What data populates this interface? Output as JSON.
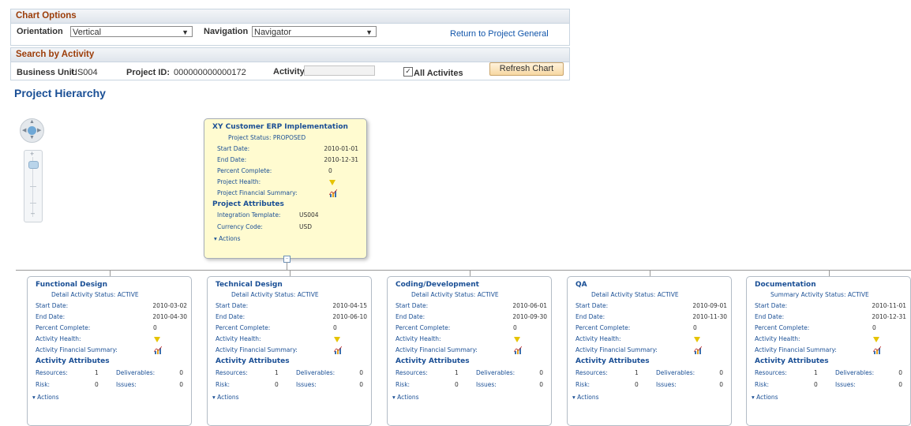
{
  "chart_options": {
    "header": "Chart Options",
    "orientation_label": "Orientation",
    "orientation_value": "Vertical",
    "navigation_label": "Navigation",
    "navigation_value": "Navigator",
    "return_link": "Return to Project General"
  },
  "search": {
    "header": "Search by Activity",
    "business_unit_label": "Business Unit:",
    "business_unit_value": "US004",
    "project_id_label": "Project ID:",
    "project_id_value": "000000000000172",
    "activity_label": "Activity:",
    "activity_value": "",
    "all_activities_label": "All Activites",
    "all_activities_checked": true,
    "refresh_button": "Refresh Chart"
  },
  "page_title": "Project Hierarchy",
  "root": {
    "title": "XY Customer ERP Implementation",
    "status": "Project Status: PROPOSED",
    "rows": [
      {
        "label": "Start Date:",
        "value": "2010-01-01"
      },
      {
        "label": "End Date:",
        "value": "2010-12-31"
      },
      {
        "label": "Percent Complete:",
        "value": "0"
      },
      {
        "label": "Project Health:",
        "value": ""
      },
      {
        "label": "Project Financial Summary:",
        "value": ""
      }
    ],
    "attributes_header": "Project Attributes",
    "attributes": [
      {
        "label": "Integration Template:",
        "value": "US004"
      },
      {
        "label": "Currency Code:",
        "value": "USD"
      }
    ],
    "actions": "Actions",
    "health_color": "#e6c300"
  },
  "activities": [
    {
      "title": "Functional Design",
      "status": "Detail Activity Status: ACTIVE",
      "start": "2010-03-02",
      "end": "2010-04-30",
      "percent": "0",
      "resources": "1",
      "deliverables": "0",
      "risk": "0",
      "issues": "0"
    },
    {
      "title": "Technical Design",
      "status": "Detail Activity Status: ACTIVE",
      "start": "2010-04-15",
      "end": "2010-06-10",
      "percent": "0",
      "resources": "1",
      "deliverables": "0",
      "risk": "0",
      "issues": "0"
    },
    {
      "title": "Coding/Development",
      "status": "Detail Activity Status: ACTIVE",
      "start": "2010-06-01",
      "end": "2010-09-30",
      "percent": "0",
      "resources": "1",
      "deliverables": "0",
      "risk": "0",
      "issues": "0"
    },
    {
      "title": "QA",
      "status": "Detail Activity Status: ACTIVE",
      "start": "2010-09-01",
      "end": "2010-11-30",
      "percent": "0",
      "resources": "1",
      "deliverables": "0",
      "risk": "0",
      "issues": "0"
    },
    {
      "title": "Documentation",
      "status": "Summary Activity Status: ACTIVE",
      "start": "2010-11-01",
      "end": "2010-12-31",
      "percent": "0",
      "resources": "1",
      "deliverables": "0",
      "risk": "0",
      "issues": "0"
    }
  ],
  "activity_labels": {
    "start": "Start Date:",
    "end": "End Date:",
    "percent": "Percent Complete:",
    "health": "Activity Health:",
    "financial": "Activity Financial Summary:",
    "attributes_header": "Activity Attributes",
    "resources": "Resources:",
    "deliverables": "Deliverables:",
    "risk": "Risk:",
    "issues": "Issues:",
    "actions": "Actions"
  }
}
